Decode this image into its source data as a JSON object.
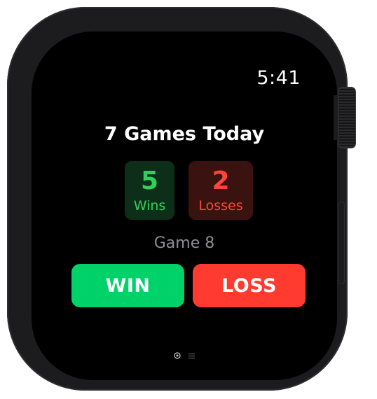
{
  "status_bar": {
    "time": "5:41"
  },
  "summary": {
    "headline": "7 Games Today",
    "wins": {
      "value": "5",
      "label": "Wins",
      "color": "#30d158"
    },
    "losses": {
      "value": "2",
      "label": "Losses",
      "color": "#ff453a"
    }
  },
  "current_game": {
    "label": "Game 8"
  },
  "actions": {
    "win_label": "WIN",
    "win_color": "#00d26a",
    "loss_label": "LOSS",
    "loss_color": "#ff3b30"
  },
  "page_indicator": {
    "pages": [
      {
        "icon": "circle-target-icon",
        "active": true
      },
      {
        "icon": "list-icon",
        "active": false
      }
    ]
  }
}
